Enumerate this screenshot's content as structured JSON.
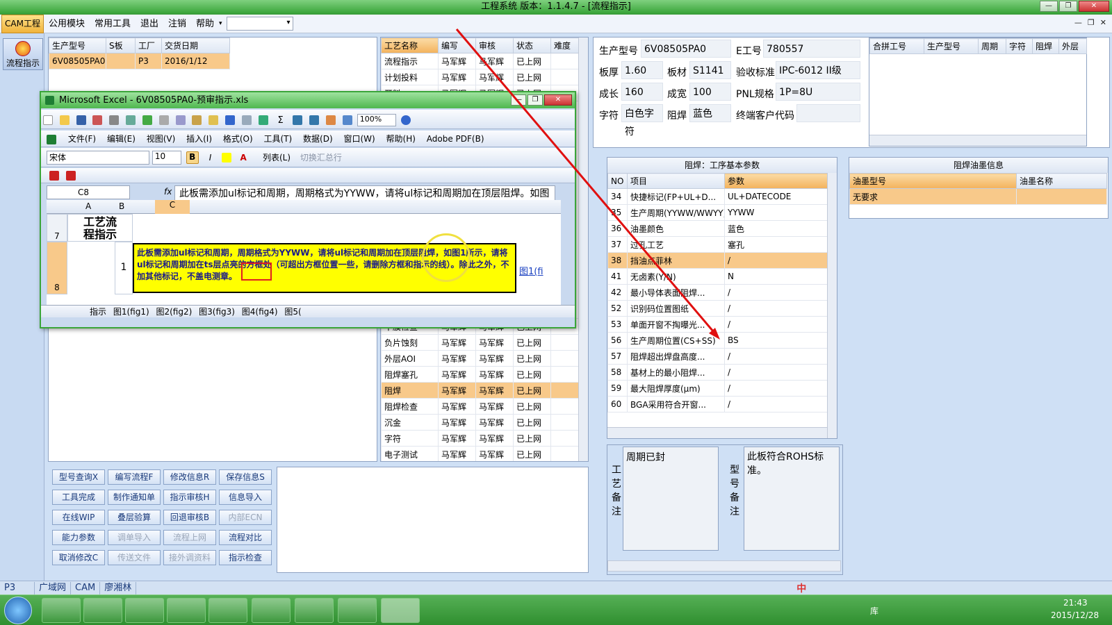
{
  "window": {
    "title": "工程系统   版本：1.1.4.7 - [流程指示]"
  },
  "menu": {
    "active": "CAM工程",
    "items": [
      "公用模块",
      "常用工具",
      "退出",
      "注销",
      "帮助"
    ]
  },
  "left_nav": {
    "button_label": "流程指示"
  },
  "order_table": {
    "headers": [
      "生产型号",
      "S板",
      "工厂",
      "交货日期"
    ],
    "row": [
      "6V08505PA0",
      "",
      "P3",
      "2016/1/12"
    ]
  },
  "process_table": {
    "headers": [
      "工艺名称",
      "编写",
      "审核",
      "状态",
      "难度"
    ],
    "rows_top": [
      [
        "流程指示",
        "马军辉",
        "马军辉",
        "已上网"
      ],
      [
        "计划投料",
        "马军辉",
        "马军辉",
        "已上网"
      ],
      [
        "开料",
        "马军辉",
        "马军辉",
        "已上网"
      ]
    ],
    "rows_bottom": [
      [
        "干膜检查",
        "马军辉",
        "马军辉",
        "已上网"
      ],
      [
        "负片蚀刻",
        "马军辉",
        "马军辉",
        "已上网"
      ],
      [
        "外层AOI",
        "马军辉",
        "马军辉",
        "已上网"
      ],
      [
        "阻焊塞孔",
        "马军辉",
        "马军辉",
        "已上网"
      ],
      [
        "阻焊",
        "马军辉",
        "马军辉",
        "已上网"
      ],
      [
        "阻焊检查",
        "马军辉",
        "马军辉",
        "已上网"
      ],
      [
        "沉金",
        "马军辉",
        "马军辉",
        "已上网"
      ],
      [
        "字符",
        "马军辉",
        "马军辉",
        "已上网"
      ],
      [
        "电子测试",
        "马军辉",
        "马军辉",
        "已上网"
      ]
    ]
  },
  "action_buttons": [
    [
      "型号查询X",
      "编写流程F",
      "修改信息R",
      "保存信息S"
    ],
    [
      "工具完成",
      "制作通知单",
      "指示审核H",
      "信息导入"
    ],
    [
      "在线WIP",
      "叠层验算",
      "回退审核B",
      "内部ECN"
    ],
    [
      "能力参数",
      "调单导入",
      "流程上网",
      "流程对比"
    ],
    [
      "取消修改C",
      "传送文件",
      "接外调资料",
      "指示检查"
    ]
  ],
  "info": {
    "prod_model_label": "生产型号",
    "prod_model": "6V08505PA0",
    "e_no_label": "E工号",
    "e_no": "780557",
    "thickness_label": "板厚",
    "thickness": "1.60",
    "material_label": "板材",
    "material": "S1141",
    "standard_label": "验收标准",
    "standard": "IPC-6012 II级",
    "length_label": "成长",
    "length": "160",
    "width_label": "成宽",
    "width": "100",
    "pnl_label": "PNL规格",
    "pnl": "1P=8U",
    "char_label": "字符",
    "char": "白色字符",
    "mask_label": "阻焊",
    "mask": "蓝色",
    "customer_label": "终端客户代码",
    "customer": ""
  },
  "merge_table": {
    "headers": [
      "合拼工号",
      "生产型号",
      "周期",
      "字符",
      "阻焊",
      "外层"
    ]
  },
  "params": {
    "title": "阻焊：工序基本参数",
    "headers": [
      "NO",
      "项目",
      "参数"
    ],
    "rows": [
      [
        "34",
        "快捷标记(FP+UL+D...",
        "UL+DATECODE"
      ],
      [
        "35",
        "生产周期(YYWW/WWYY)",
        "YYWW"
      ],
      [
        "36",
        "油墨颜色",
        "蓝色"
      ],
      [
        "37",
        "过孔工艺",
        "塞孔"
      ],
      [
        "38",
        "挡油点菲林",
        "/"
      ],
      [
        "41",
        "无卤素(Y/N)",
        "N"
      ],
      [
        "42",
        "最小导体表面阻焊...",
        "/"
      ],
      [
        "52",
        "识别码位置图纸",
        "/"
      ],
      [
        "53",
        "单面开窗不掏曝光...",
        "/"
      ],
      [
        "56",
        "生产周期位置(CS+SS)",
        "BS"
      ],
      [
        "57",
        "阻焊超出焊盘高度...",
        "/"
      ],
      [
        "58",
        "基材上的最小阻焊...",
        "/"
      ],
      [
        "59",
        "最大阻焊厚度(μm)",
        "/"
      ],
      [
        "60",
        "BGA采用符合开窗...",
        "/"
      ]
    ]
  },
  "ink": {
    "title": "阻焊油墨信息",
    "headers": [
      "油墨型号",
      "油墨名称"
    ],
    "row": [
      "无要求",
      ""
    ]
  },
  "notes": {
    "process_label": "工艺备注",
    "process_text": "周期已封",
    "model_label": "型号备注",
    "model_text": "此板符合ROHS标准。"
  },
  "excel": {
    "title": "Microsoft Excel - 6V08505PA0-预审指示.xls",
    "menu": [
      "文件(F)",
      "编辑(E)",
      "视图(V)",
      "插入(I)",
      "格式(O)",
      "工具(T)",
      "数据(D)",
      "窗口(W)",
      "帮助(H)",
      "Adobe PDF(B)"
    ],
    "zoom": "100%",
    "font": "宋体",
    "font_size": "10",
    "list_btn": "列表(L)",
    "sum_btn": "切换汇总行",
    "cell_ref": "C8",
    "fx": "fx",
    "formula": "此板需添加ul标记和周期，周期格式为YYWW，请将ul标记和周期加在顶层阻焊。如图1所示，请将ul标记和周期加在ts层点亮的方框处（可超出方框位置一些，请删除方框和指示的线）。除此之外，不加其他标记，不盖电测章。",
    "cols": [
      "A",
      "B",
      "C"
    ],
    "row7_num": "7",
    "row8_num": "8",
    "row7_title": "工艺流程指示",
    "row8_b": "1",
    "cell_text": "此板需添加ul标记和周期，周期格式为YYWW，请将ul标记和周期加在顶层阻焊，如图1所示，请将ul标记和周期加在ts层点亮的方框处（可超出方框位置一些，请删除方框和指示的线）。除此之外，不加其他标记，不盖电测章。",
    "link_text": "图1(fi",
    "sheets": [
      "指示",
      "图1(fig1)",
      "图2(fig2)",
      "图3(fig3)",
      "图4(fig4)",
      "图5("
    ]
  },
  "statusbar": [
    "P3",
    "广域网",
    "CAM",
    "廖湘林"
  ],
  "ime": "中",
  "tray": {
    "library": "库",
    "time": "21:43",
    "date": "2015/12/28"
  }
}
